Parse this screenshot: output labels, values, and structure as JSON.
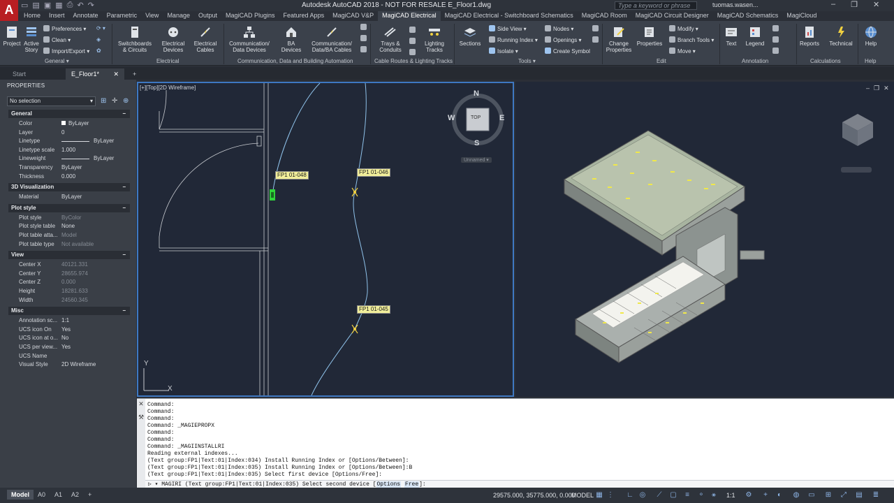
{
  "window": {
    "title": "Autodesk AutoCAD 2018 - NOT FOR RESALE    E_Floor1.dwg",
    "search_placeholder": "Type a keyword or phrase",
    "user": "tuomas.wasen..."
  },
  "ribbon_tabs": [
    "Home",
    "Insert",
    "Annotate",
    "Parametric",
    "View",
    "Manage",
    "Output",
    "MagiCAD Plugins",
    "Featured Apps",
    "MagiCAD V&P",
    "MagiCAD Electrical",
    "MagiCAD Electrical - Switchboard Schematics",
    "MagiCAD Room",
    "MagiCAD Circuit Designer",
    "MagiCAD Schematics",
    "MagiCloud"
  ],
  "active_tab": "MagiCAD Electrical",
  "ribbon": {
    "project": "Project",
    "active_story": "Active Story",
    "preferences": "Preferences",
    "clean": "Clean",
    "import_export": "Import/Export",
    "switchboards": "Switchboards & Circuits",
    "electrical_devices": "Electrical Devices",
    "electrical_cables": "Electrical Cables",
    "comm_data_devices": "Communication/ Data Devices",
    "ba_devices": "BA Devices",
    "comm_data_cables": "Communication/ Data/BA Cables",
    "trays_conduits": "Trays & Conduits",
    "lighting_tracks": "Lighting Tracks",
    "sections": "Sections",
    "side_view": "Side View",
    "running_index": "Running Index",
    "isolate": "Isolate",
    "nodes": "Nodes",
    "openings": "Openings",
    "create_symbol": "Create Symbol",
    "change_properties": "Change Properties",
    "properties": "Properties",
    "modify": "Modify",
    "branch_tools": "Branch Tools",
    "move": "Move",
    "text": "Text",
    "legend": "Legend",
    "reports": "Reports",
    "technical": "Technical",
    "help": "Help",
    "groups": {
      "general": "General",
      "electrical": "Electrical",
      "comm": "Communication, Data and Building Automation",
      "cable_routes": "Cable Routes & Lighting Tracks",
      "tools": "Tools",
      "edit": "Edit",
      "annotation": "Annotation",
      "calculations": "Calculations",
      "help": "Help"
    }
  },
  "file_tabs": [
    "Start",
    "E_Floor1*"
  ],
  "properties": {
    "title": "PROPERTIES",
    "selection": "No selection",
    "sections": {
      "general": "General",
      "visualization": "3D Visualization",
      "plot_style": "Plot style",
      "view": "View",
      "misc": "Misc"
    },
    "general": [
      {
        "k": "Color",
        "v": "ByLayer"
      },
      {
        "k": "Layer",
        "v": "0"
      },
      {
        "k": "Linetype",
        "v": "ByLayer"
      },
      {
        "k": "Linetype scale",
        "v": "1.000"
      },
      {
        "k": "Lineweight",
        "v": "ByLayer"
      },
      {
        "k": "Transparency",
        "v": "ByLayer"
      },
      {
        "k": "Thickness",
        "v": "0.000"
      }
    ],
    "visualization": [
      {
        "k": "Material",
        "v": "ByLayer"
      }
    ],
    "plot_style": [
      {
        "k": "Plot style",
        "v": "ByColor"
      },
      {
        "k": "Plot style table",
        "v": "None"
      },
      {
        "k": "Plot table atta...",
        "v": "Model"
      },
      {
        "k": "Plot table type",
        "v": "Not available"
      }
    ],
    "view": [
      {
        "k": "Center X",
        "v": "40121.331"
      },
      {
        "k": "Center Y",
        "v": "28655.974"
      },
      {
        "k": "Center Z",
        "v": "0.000"
      },
      {
        "k": "Height",
        "v": "18281.633"
      },
      {
        "k": "Width",
        "v": "24560.345"
      }
    ],
    "misc": [
      {
        "k": "Annotation sc...",
        "v": "1:1"
      },
      {
        "k": "UCS icon On",
        "v": "Yes"
      },
      {
        "k": "UCS icon at o...",
        "v": "No"
      },
      {
        "k": "UCS per view...",
        "v": "Yes"
      },
      {
        "k": "UCS Name",
        "v": ""
      },
      {
        "k": "Visual Style",
        "v": "2D Wireframe"
      }
    ]
  },
  "viewport": {
    "label": "[+][Top][2D Wireframe]",
    "compass": {
      "n": "N",
      "s": "S",
      "e": "E",
      "w": "W",
      "top": "TOP"
    },
    "ucs_name": "Unnamed",
    "tags": [
      "FP1 01-048",
      "FP1 01-046",
      "FP1 01-045"
    ],
    "axis_y": "Y",
    "axis_x": "X"
  },
  "command": {
    "lines": [
      "Command:",
      "Command:",
      "Command:",
      "Command: _MAGIEPROPX",
      "Command:",
      "Command:",
      "Command: _MAGIINSTALLRI",
      "Reading external indexes...",
      "(Text group:FP1|Text:01|Index:034) Install Running Index or [Options/Between]:",
      "(Text group:FP1|Text:01|Index:035) Install Running Index or [Options/Between]:B",
      "(Text group:FP1|Text:01|Index:035) Select first device [Options/Free]:"
    ],
    "prompt": "MAGIRI (Text group:FP1|Text:01|Index:035) Select second device [",
    "opt1": "Options",
    "opt2": "Free",
    "prompt_end": "]:"
  },
  "status": {
    "layout_tabs": [
      "Model",
      "A0",
      "A1",
      "A2"
    ],
    "coords": "29575.000, 35775.000, 0.000",
    "model": "MODEL",
    "scale": "1:1"
  },
  "colors": {
    "accent": "#3e78c2",
    "tag_bg": "#f1ee9a",
    "device_green": "#2fd33a"
  }
}
